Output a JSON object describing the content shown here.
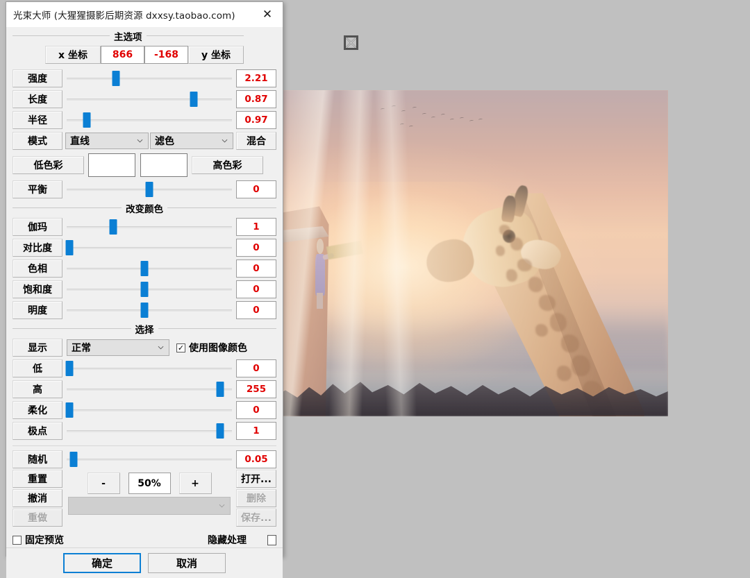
{
  "window": {
    "title": "光束大师 (大猩猩摄影后期资源 dxxsy.taobao.com)",
    "close_icon": "close-icon"
  },
  "groups": {
    "main_options": "主选项",
    "change_color": "改变颜色",
    "selection": "选择"
  },
  "coords": {
    "x_label": "x 坐标",
    "x_value": "866",
    "y_value": "-168",
    "y_label": "y 坐标"
  },
  "main_sliders": [
    {
      "label": "强度",
      "value": "2.21",
      "pos": 30
    },
    {
      "label": "长度",
      "value": "0.87",
      "pos": 77
    },
    {
      "label": "半径",
      "value": "0.97",
      "pos": 12
    }
  ],
  "mode_row": {
    "label": "模式",
    "shape_option": "直线",
    "blend_option": "滤色",
    "blend_label": "混合"
  },
  "color_row": {
    "low_label": "低色彩",
    "low_swatch": "#ffffff",
    "high_swatch": "#ffffff",
    "high_label": "高色彩"
  },
  "balance": {
    "label": "平衡",
    "value": "0",
    "pos": 50
  },
  "color_sliders": [
    {
      "label": "伽玛",
      "value": "1",
      "pos": 28
    },
    {
      "label": "对比度",
      "value": "0",
      "pos": 1
    },
    {
      "label": "色相",
      "value": "0",
      "pos": 47
    },
    {
      "label": "饱和度",
      "value": "0",
      "pos": 47
    },
    {
      "label": "明度",
      "value": "0",
      "pos": 47
    }
  ],
  "display_row": {
    "label": "显示",
    "option": "正常",
    "use_image_color_label": "使用图像颜色",
    "use_image_color_checked": true
  },
  "selection_sliders": [
    {
      "label": "低",
      "value": "0",
      "pos": 1
    },
    {
      "label": "高",
      "value": "255",
      "pos": 93
    },
    {
      "label": "柔化",
      "value": "0",
      "pos": 1
    },
    {
      "label": "极点",
      "value": "1",
      "pos": 93
    }
  ],
  "random": {
    "label": "随机",
    "value": "0.05",
    "pos": 4
  },
  "actions": {
    "reset": "重置",
    "undo": "撤消",
    "redo": "重做",
    "open": "打开...",
    "delete": "删除",
    "save": "保存..."
  },
  "zoom": {
    "minus": "-",
    "level": "50%",
    "plus": "+",
    "preset_placeholder": ""
  },
  "bottom_checks": {
    "fixed_preview_label": "固定预览",
    "fixed_preview_checked": false,
    "hide_process_label": "隐藏处理",
    "hide_process_checked": false
  },
  "footer": {
    "ok": "确定",
    "cancel": "取消"
  },
  "canvas": {
    "handle_icon": "image-placeholder-x-icon",
    "background_color": "#c0c0c0"
  }
}
